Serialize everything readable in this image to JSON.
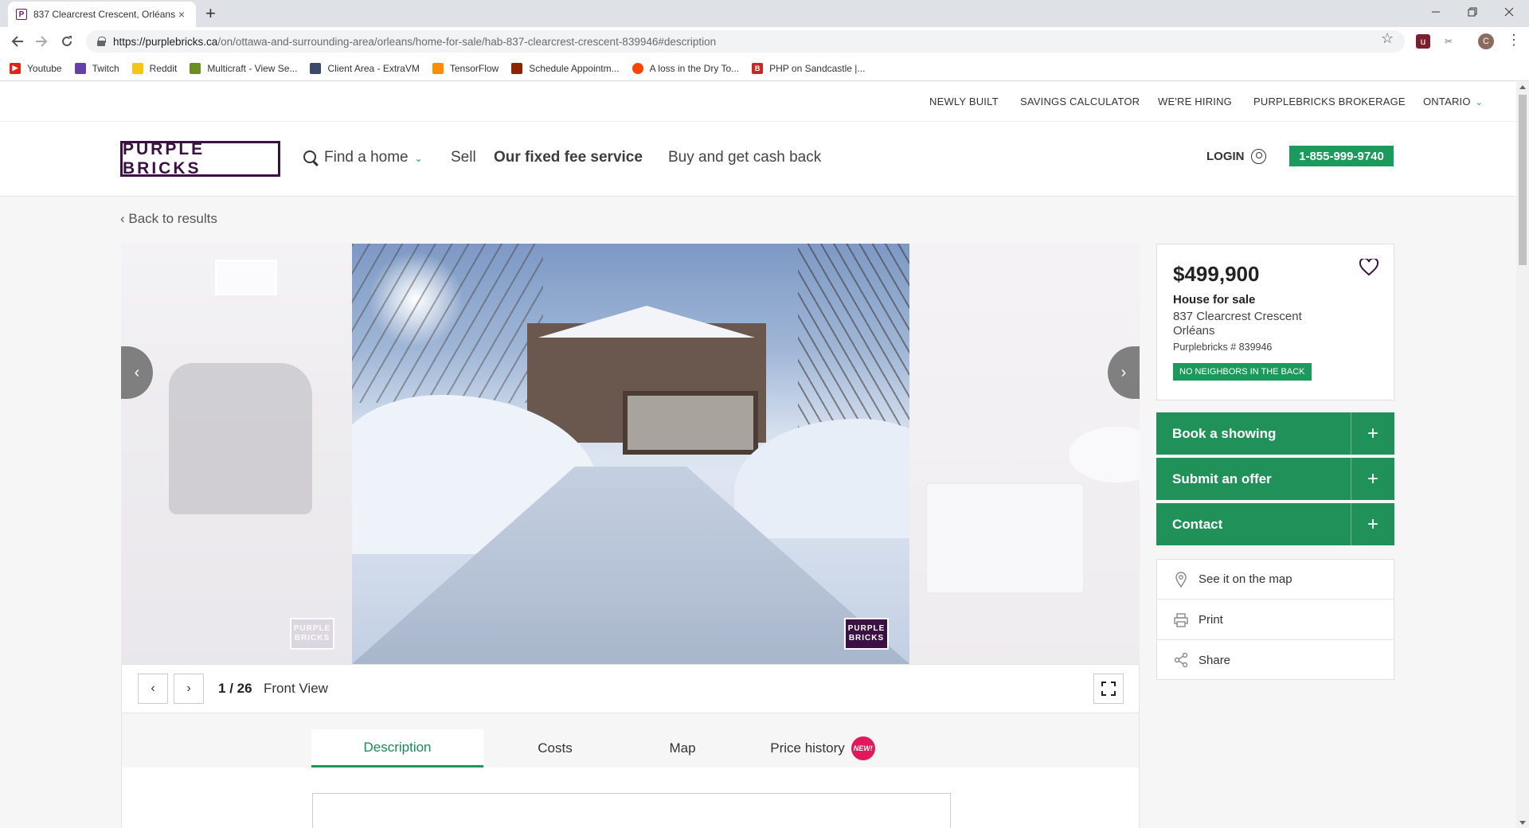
{
  "browser": {
    "tab_title": "837 Clearcrest Crescent, Orléans",
    "tab_close": "×",
    "new_tab": "+",
    "url_host": "https://purplebricks.ca",
    "url_path": "/on/ottawa-and-surrounding-area/orleans/home-for-sale/hab-837-clearcrest-crescent-839946#description",
    "profile_initial": "C",
    "bookmarks": [
      {
        "label": "Youtube",
        "color": "#e62117",
        "icon": "youtube-icon"
      },
      {
        "label": "Twitch",
        "color": "#6441a5",
        "icon": "twitch-icon"
      },
      {
        "label": "Reddit",
        "color": "#f5c518",
        "icon": "folder-icon"
      },
      {
        "label": "Multicraft - View Se...",
        "color": "#6b8e23",
        "icon": "multicraft-icon"
      },
      {
        "label": "Client Area - ExtraVM",
        "color": "#3a4a6b",
        "icon": "extravm-icon"
      },
      {
        "label": "TensorFlow",
        "color": "#ff8f00",
        "icon": "tensorflow-icon"
      },
      {
        "label": "Schedule Appointm...",
        "color": "#8b2500",
        "icon": "schedule-icon"
      },
      {
        "label": "A loss in the Dry To...",
        "color": "#ff4500",
        "icon": "reddit-icon"
      },
      {
        "label": "PHP on Sandcastle |...",
        "color": "#c62828",
        "icon": "php-icon"
      }
    ]
  },
  "utility_nav": {
    "items": [
      "NEWLY BUILT",
      "SAVINGS CALCULATOR",
      "WE'RE HIRING",
      "PURPLEBRICKS BROKERAGE"
    ],
    "region": "ONTARIO"
  },
  "main_nav": {
    "logo": "PURPLE BRICKS",
    "find_home": "Find a home",
    "sell": "Sell",
    "fixed_fee": "Our fixed fee service",
    "cash_back": "Buy and get cash back",
    "login": "LOGIN",
    "phone": "1-855-999-9740"
  },
  "back_link": "‹ Back to results",
  "gallery": {
    "current": "1",
    "total": "/ 26",
    "caption": "Front View",
    "watermark_line1": "PURPLE",
    "watermark_line2": "BRICKS"
  },
  "tabs": [
    {
      "label": "Description",
      "active": true
    },
    {
      "label": "Costs",
      "active": false
    },
    {
      "label": "Map",
      "active": false
    },
    {
      "label": "Price history",
      "active": false,
      "badge": "NEW!"
    }
  ],
  "listing": {
    "price": "$499,900",
    "type": "House for sale",
    "address_line1": "837 Clearcrest Crescent",
    "address_line2": "Orléans",
    "pb_number": "Purplebricks # 839946",
    "tag": "NO NEIGHBORS IN THE BACK"
  },
  "actions": [
    "Book a showing",
    "Submit an offer",
    "Contact"
  ],
  "links": [
    {
      "label": "See it on the map",
      "icon": "map-pin-icon"
    },
    {
      "label": "Print",
      "icon": "printer-icon"
    },
    {
      "label": "Share",
      "icon": "share-icon"
    }
  ],
  "colors": {
    "brand_purple": "#3b1042",
    "accent_green": "#1a9a5b",
    "badge_pink": "#e3185b"
  }
}
